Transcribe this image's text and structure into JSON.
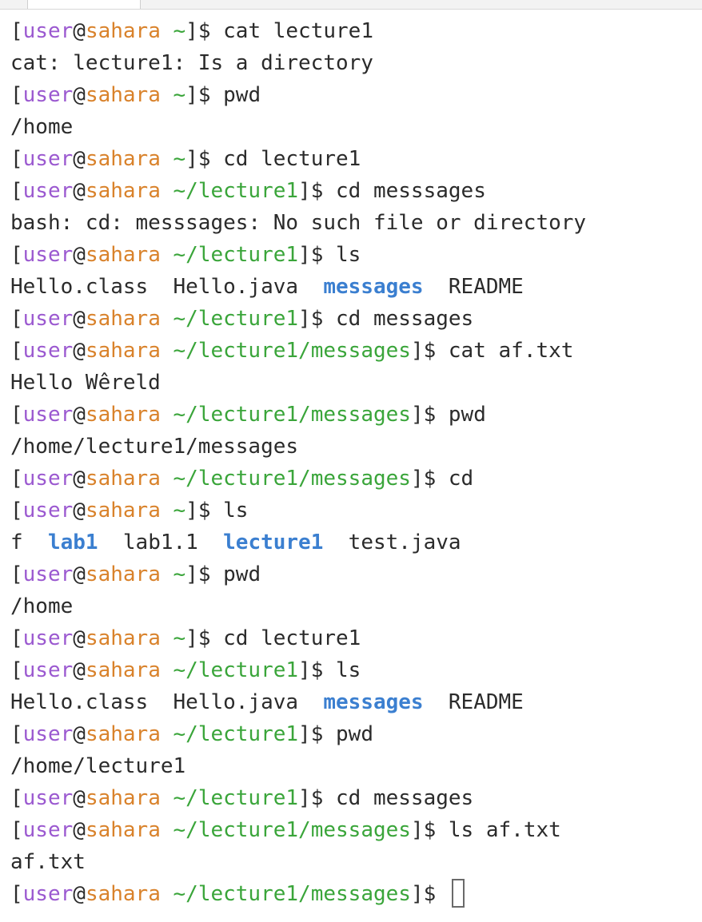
{
  "prompt": {
    "user": "user",
    "at": "@",
    "host": "sahara",
    "open": "[",
    "close": "]$ "
  },
  "lines": [
    {
      "type": "prompt",
      "dir": " ~",
      "cmd": "cat lecture1"
    },
    {
      "type": "output",
      "parts": [
        {
          "text": "cat: lecture1: Is a directory"
        }
      ]
    },
    {
      "type": "prompt",
      "dir": " ~",
      "cmd": "pwd"
    },
    {
      "type": "output",
      "parts": [
        {
          "text": "/home"
        }
      ]
    },
    {
      "type": "prompt",
      "dir": " ~",
      "cmd": "cd lecture1"
    },
    {
      "type": "prompt",
      "dir": " ~/lecture1",
      "cmd": "cd messsages"
    },
    {
      "type": "output",
      "parts": [
        {
          "text": "bash: cd: messsages: No such file or directory"
        }
      ]
    },
    {
      "type": "prompt",
      "dir": " ~/lecture1",
      "cmd": "ls"
    },
    {
      "type": "output",
      "parts": [
        {
          "text": "Hello.class  Hello.java  "
        },
        {
          "text": "messages",
          "dir": true
        },
        {
          "text": "  README"
        }
      ]
    },
    {
      "type": "prompt",
      "dir": " ~/lecture1",
      "cmd": "cd messages"
    },
    {
      "type": "prompt",
      "dir": " ~/lecture1/messages",
      "cmd": "cat af.txt"
    },
    {
      "type": "output",
      "parts": [
        {
          "text": "Hello Wêreld"
        }
      ]
    },
    {
      "type": "prompt",
      "dir": " ~/lecture1/messages",
      "cmd": "pwd"
    },
    {
      "type": "output",
      "parts": [
        {
          "text": "/home/lecture1/messages"
        }
      ]
    },
    {
      "type": "prompt",
      "dir": " ~/lecture1/messages",
      "cmd": "cd"
    },
    {
      "type": "prompt",
      "dir": " ~",
      "cmd": "ls"
    },
    {
      "type": "output",
      "parts": [
        {
          "text": "f  "
        },
        {
          "text": "lab1",
          "dir": true
        },
        {
          "text": "  lab1.1  "
        },
        {
          "text": "lecture1",
          "dir": true
        },
        {
          "text": "  test.java"
        }
      ]
    },
    {
      "type": "prompt",
      "dir": " ~",
      "cmd": "pwd"
    },
    {
      "type": "output",
      "parts": [
        {
          "text": "/home"
        }
      ]
    },
    {
      "type": "prompt",
      "dir": " ~",
      "cmd": "cd lecture1"
    },
    {
      "type": "prompt",
      "dir": " ~/lecture1",
      "cmd": "ls"
    },
    {
      "type": "output",
      "parts": [
        {
          "text": "Hello.class  Hello.java  "
        },
        {
          "text": "messages",
          "dir": true
        },
        {
          "text": "  README"
        }
      ]
    },
    {
      "type": "prompt",
      "dir": " ~/lecture1",
      "cmd": "pwd"
    },
    {
      "type": "output",
      "parts": [
        {
          "text": "/home/lecture1"
        }
      ]
    },
    {
      "type": "prompt",
      "dir": " ~/lecture1",
      "cmd": "cd messages"
    },
    {
      "type": "prompt",
      "dir": " ~/lecture1/messages",
      "cmd": "ls af.txt"
    },
    {
      "type": "output",
      "parts": [
        {
          "text": "af.txt"
        }
      ]
    },
    {
      "type": "prompt",
      "dir": " ~/lecture1/messages",
      "cmd": "",
      "cursor": true
    }
  ],
  "colors": {
    "user": "#9b59d0",
    "host": "#d9822b",
    "path": "#3aa53a",
    "directory": "#3b7fd0",
    "text": "#2b2b2b",
    "background": "#ffffff"
  }
}
